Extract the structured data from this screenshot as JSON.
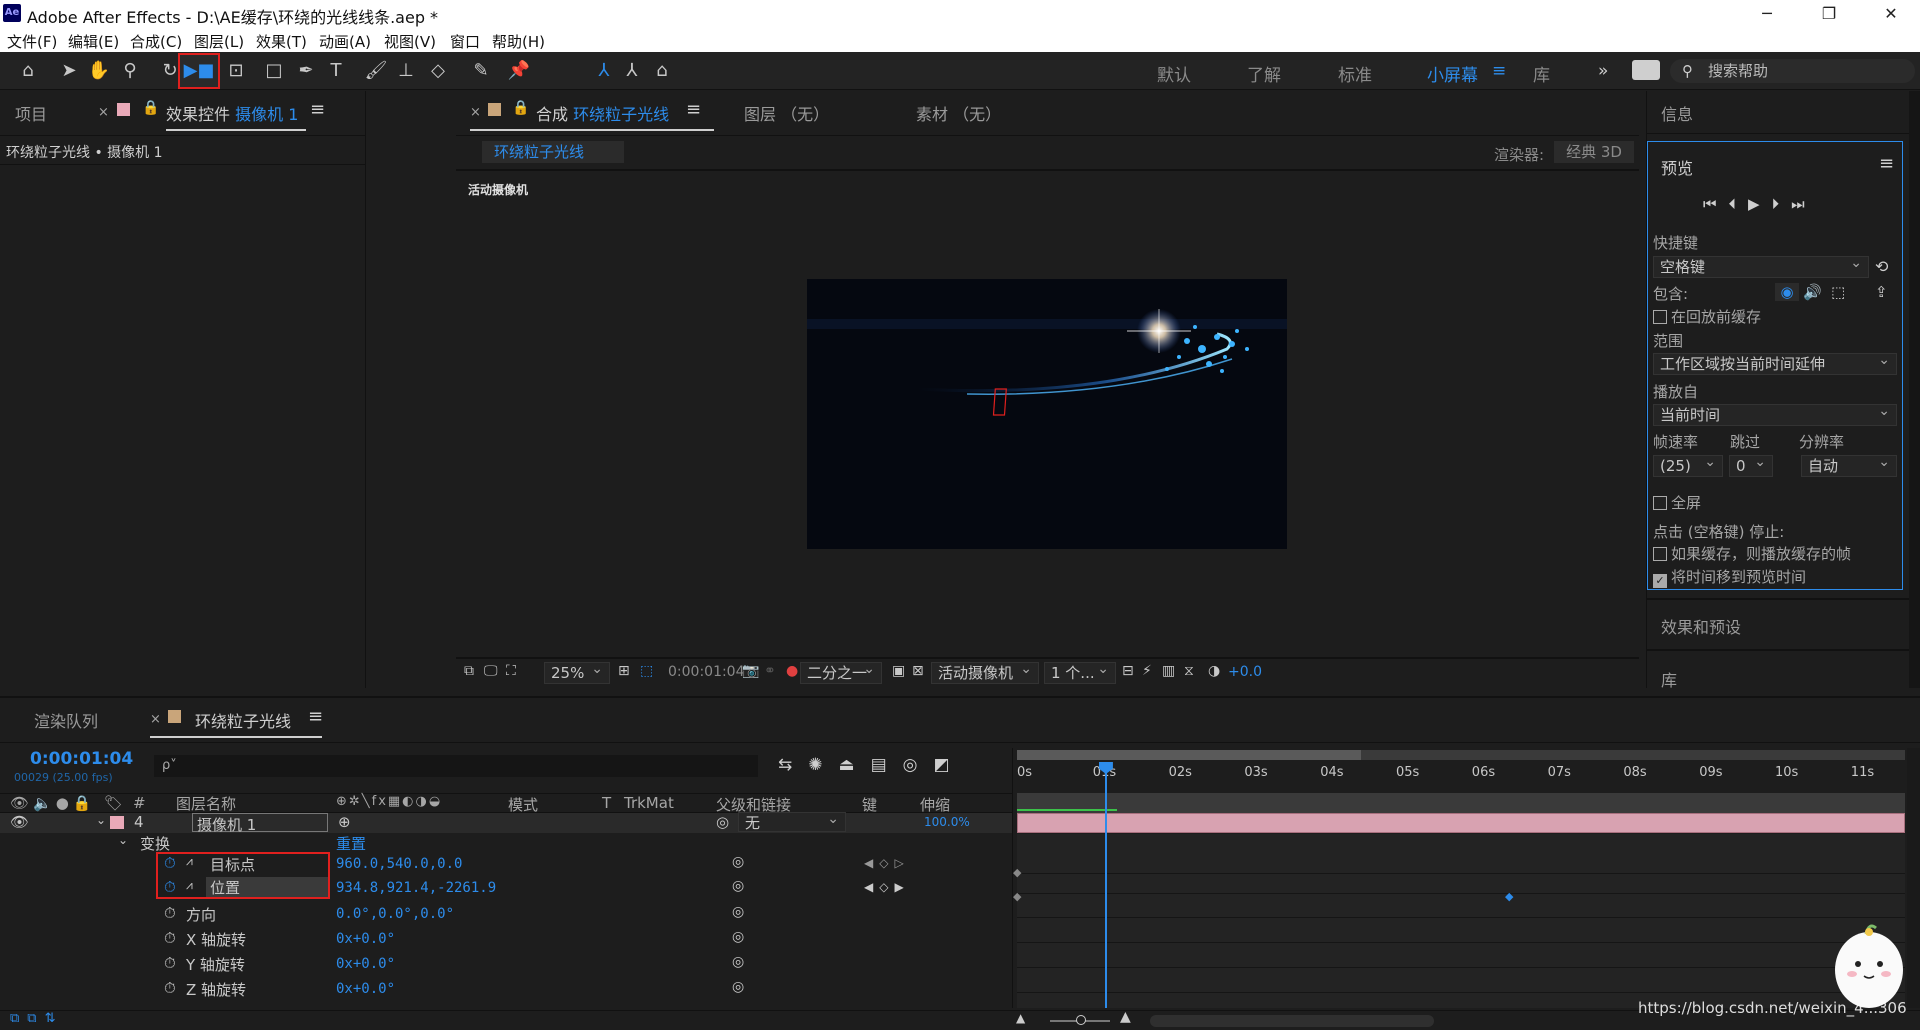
{
  "window": {
    "app_icon": "Ae",
    "title": "Adobe After Effects - D:\\AE缓存\\环绕的光线线条.aep *",
    "minimize": "─",
    "maximize": "❐",
    "close": "✕"
  },
  "menu": [
    "文件(F)",
    "编辑(E)",
    "合成(C)",
    "图层(L)",
    "效果(T)",
    "动画(A)",
    "视图(V)",
    "窗口",
    "帮助(H)"
  ],
  "toolbar": {
    "workspaces": [
      "默认",
      "了解",
      "标准",
      "小屏幕",
      "库"
    ],
    "active_workspace": "小屏幕",
    "more": "»",
    "search_help": "搜索帮助"
  },
  "left_panel": {
    "tab_project": "项目",
    "tab_effects_prefix": "效果控件",
    "tab_effects_target": "摄像机 1",
    "breadcrumb": "环绕粒子光线 • 摄像机 1"
  },
  "comp_panel": {
    "tab_comp_prefix": "合成",
    "tab_comp_name": "环绕粒子光线",
    "tab_layer": "图层 （无）",
    "tab_footage": "素材 （无）",
    "comp_chip": "环绕粒子光线",
    "renderer_label": "渲染器:",
    "renderer_value": "经典 3D",
    "view_label": "活动摄像机",
    "footer": {
      "zoom": "25%",
      "timecode": "0:00:01:04",
      "resolution": "二分之一",
      "camera": "活动摄像机",
      "views": "1 个...",
      "exposure": "+0.0"
    }
  },
  "right_panel": {
    "info": "信息",
    "preview": "预览",
    "shortcut_label": "快捷键",
    "shortcut_value": "空格键",
    "include_label": "包含:",
    "cache_before": "在回放前缓存",
    "range_label": "范围",
    "range_value": "工作区域按当前时间延伸",
    "play_from_label": "播放自",
    "play_from_value": "当前时间",
    "fps_label": "帧速率",
    "skip_label": "跳过",
    "res_label": "分辨率",
    "fps_value": "(25)",
    "skip_value": "0",
    "res_value": "自动",
    "fullscreen": "全屏",
    "stop_label": "点击 (空格键) 停止:",
    "if_cached": "如果缓存，则播放缓存的帧",
    "move_time": "将时间移到预览时间",
    "effects_presets": "效果和预设",
    "library": "库"
  },
  "timeline": {
    "tab_render": "渲染队列",
    "tab_comp": "环绕粒子光线",
    "timecode": "0:00:01:04",
    "frames": "00029 (25.00 fps)",
    "search_placeholder": "ρ˅",
    "headers": {
      "num": "#",
      "layer_name": "图层名称",
      "mode": "模式",
      "t": "T",
      "trkmat": "TrkMat",
      "parent": "父级和链接",
      "keys": "键",
      "stretch": "伸缩"
    },
    "layer": {
      "index": "4",
      "name": "摄像机 1",
      "parent": "无",
      "stretch": "100.0%"
    },
    "transform": "变换",
    "reset": "重置",
    "properties": [
      {
        "name": "目标点",
        "value": "960.0,540.0,0.0"
      },
      {
        "name": "位置",
        "value": "934.8,921.4,-2261.9"
      },
      {
        "name": "方向",
        "value": "0.0°,0.0°,0.0°"
      },
      {
        "name": "X 轴旋转",
        "value": "0x+0.0°"
      },
      {
        "name": "Y 轴旋转",
        "value": "0x+0.0°"
      },
      {
        "name": "Z 轴旋转",
        "value": "0x+0.0°"
      }
    ],
    "ruler": [
      "0s",
      "01s",
      "02s",
      "03s",
      "04s",
      "05s",
      "06s",
      "07s",
      "08s",
      "09s",
      "10s",
      "11s"
    ],
    "current_time_seconds": 1.16
  },
  "watermark": "https://blog.csdn.net/weixin_4...306",
  "colors": {
    "accent": "#2d8ceb",
    "highlight": "#e0201e",
    "layer_label": "#e9a9b8",
    "comp_label": "#c9a57a"
  }
}
